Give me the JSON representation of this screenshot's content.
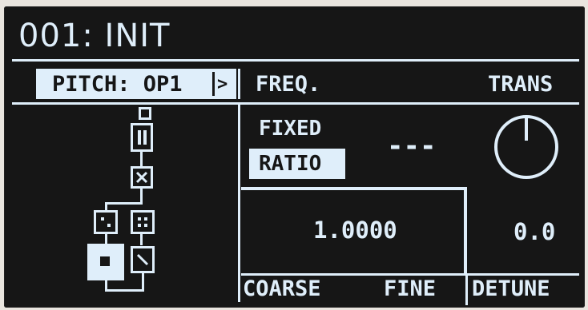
{
  "header": {
    "title": "001: INIT"
  },
  "param_bar": {
    "page_label": "PITCH: OP1",
    "next_arrow": ">",
    "col_freq": "FREQ.",
    "col_trans": "TRANS"
  },
  "mode": {
    "option_fixed": "FIXED",
    "option_ratio": "RATIO",
    "selected": "RATIO",
    "fixed_value": "---"
  },
  "ratio": {
    "value": "1.0000"
  },
  "detune": {
    "value": "0.0"
  },
  "footer": {
    "coarse": "COARSE",
    "fine": "FINE",
    "detune": "DETUNE"
  },
  "algorithm": {
    "selected_operator": "OP1",
    "operator_icons": [
      "stack-1-icon",
      "stack-2-icon",
      "cross-icon",
      "dots-2-icon",
      "dots-4-icon",
      "diag-icon",
      "selected-square-icon"
    ]
  },
  "colors": {
    "foreground": "#dfeefa",
    "background": "#161616"
  }
}
